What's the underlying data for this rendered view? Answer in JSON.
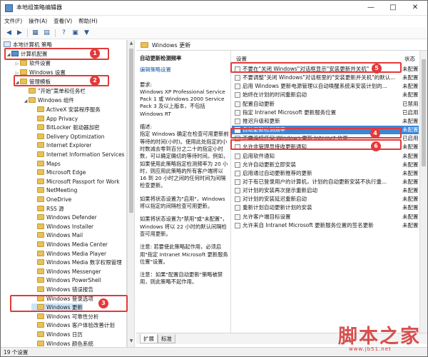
{
  "window": {
    "title": "本地组策略编辑器"
  },
  "menu": [
    "文件(F)",
    "操作(A)",
    "查看(V)",
    "帮助(H)"
  ],
  "toolbar": [
    "back-icon",
    "forward-icon",
    "folder-up-icon",
    "properties-icon",
    "help-icon",
    "filter-icon"
  ],
  "tree": {
    "root": "本地计算机 策略",
    "computer_config": "计算机配置",
    "software_settings": "软件设置",
    "windows_settings": "Windows 设置",
    "admin_templates": "管理模板",
    "start_menu": "\"开始\"菜单和任务栏",
    "windows_components": "Windows 组件",
    "items": [
      "ActiveX 安装程序服务",
      "App Privacy",
      "BitLocker 驱动器加密",
      "Delivery Optimization",
      "Internet Explorer",
      "Internet Information Services",
      "Maps",
      "Microsoft Edge",
      "Microsoft Passport for Work",
      "NetMeeting",
      "OneDrive",
      "RSS 源",
      "Windows Defender",
      "Windows Installer",
      "Windows Mail",
      "Windows Media Center",
      "Windows Media Player",
      "Windows Media 数字权限管理",
      "Windows Messenger",
      "Windows PowerShell",
      "Windows 错误报告",
      "Windows 登录选项",
      "Windows 更新",
      "Windows 可靠性分析",
      "Windows 客户体验改善计划",
      "Windows 日历",
      "Windows 颜色系统"
    ]
  },
  "section_header": "Windows 更新",
  "description": {
    "title": "自动更新检测频率",
    "edit_link": "编辑策略设置",
    "requirements_label": "要求:",
    "requirements": "Windows XP Professional Service Pack 1 或 Windows 2000 Service Pack 3 及以上版本，不包括 Windows RT",
    "desc_label": "描述:",
    "desc1": "指定 Windows 确定在检查可用更新前等待的时间(小时)。使用此处指定的小时数减去零到百分之二十的指定小时数，可以确定确切的等待时间。例如，如果使用此策略指定检测频率为 20 小时，则应用此策略的所有客户端将以 16 到 20 小时之间的任何时间为间隔检查更新。",
    "desc2": "如果将状态设置为\"启用\"，Windows 将以指定的间隔检查可用更新。",
    "desc3": "如果将状态设置为\"禁用\"或\"未配置\"，Windows 将以 22 小时的默认间隔检查可用更新。",
    "desc4": "注意: 若要使此策略起作用，必须启用\"指定 Intranet Microsoft 更新服务位置\"设置。",
    "desc5": "注意：如果\"配置自动更新\"策略被禁用，则此策略不起作用。"
  },
  "list": {
    "col_setting": "设置",
    "col_state": "状态",
    "rows": [
      {
        "name": "不要在\"关闭 Windows\"对话框显示\"安装更新并关机\"",
        "state": "未配置"
      },
      {
        "name": "不要调整\"关闭 Windows\"对话框里的\"安装更新并关机\"的默认...",
        "state": "未配置"
      },
      {
        "name": "启用 Windows 更新电源管理以自动唤醒系统来安装计划的...",
        "state": "未配置"
      },
      {
        "name": "始终在计划的时间重新启动",
        "state": "未配置"
      },
      {
        "name": "配置自动更新",
        "state": "已禁用"
      },
      {
        "name": "指定 Intranet Microsoft 更新服务位置",
        "state": "已启用"
      },
      {
        "name": "推迟升级和更新",
        "state": "未配置"
      },
      {
        "name": "自动更新检测频率",
        "state": "未配置"
      },
      {
        "name": "不要连接任何 Windows 更新 Internet 位置",
        "state": "已启用"
      },
      {
        "name": "允许非管理员接收更新通知",
        "state": "未配置"
      },
      {
        "name": "启用软件通知",
        "state": "未配置"
      },
      {
        "name": "允许自动更新立即安装",
        "state": "未配置"
      },
      {
        "name": "启用通过自动更新推荐的更新",
        "state": "未配置"
      },
      {
        "name": "对于有已登录用户的计算机，计划的自动更新安装不执行重...",
        "state": "未配置"
      },
      {
        "name": "对计划的安装再次提示重新启动",
        "state": "未配置"
      },
      {
        "name": "对计划的安装延迟重新启动",
        "state": "未配置"
      },
      {
        "name": "重新计划自动更新计划的安装",
        "state": "未配置"
      },
      {
        "name": "允许客户端目标设置",
        "state": "未配置"
      },
      {
        "name": "允许来自 Intranet Microsoft 更新服务位置的签名更新",
        "state": "未配置"
      }
    ]
  },
  "tabs": [
    "扩展",
    "标准"
  ],
  "status": "19 个设置",
  "callouts": [
    "1",
    "2",
    "3",
    "4",
    "5",
    "6"
  ],
  "watermark": {
    "brand": "脚本之家",
    "url": "www.jb51.net"
  },
  "colors": {
    "selection": "#3c86d7",
    "callout": "#e23a3a",
    "tree_selection": "#cce4f7"
  }
}
